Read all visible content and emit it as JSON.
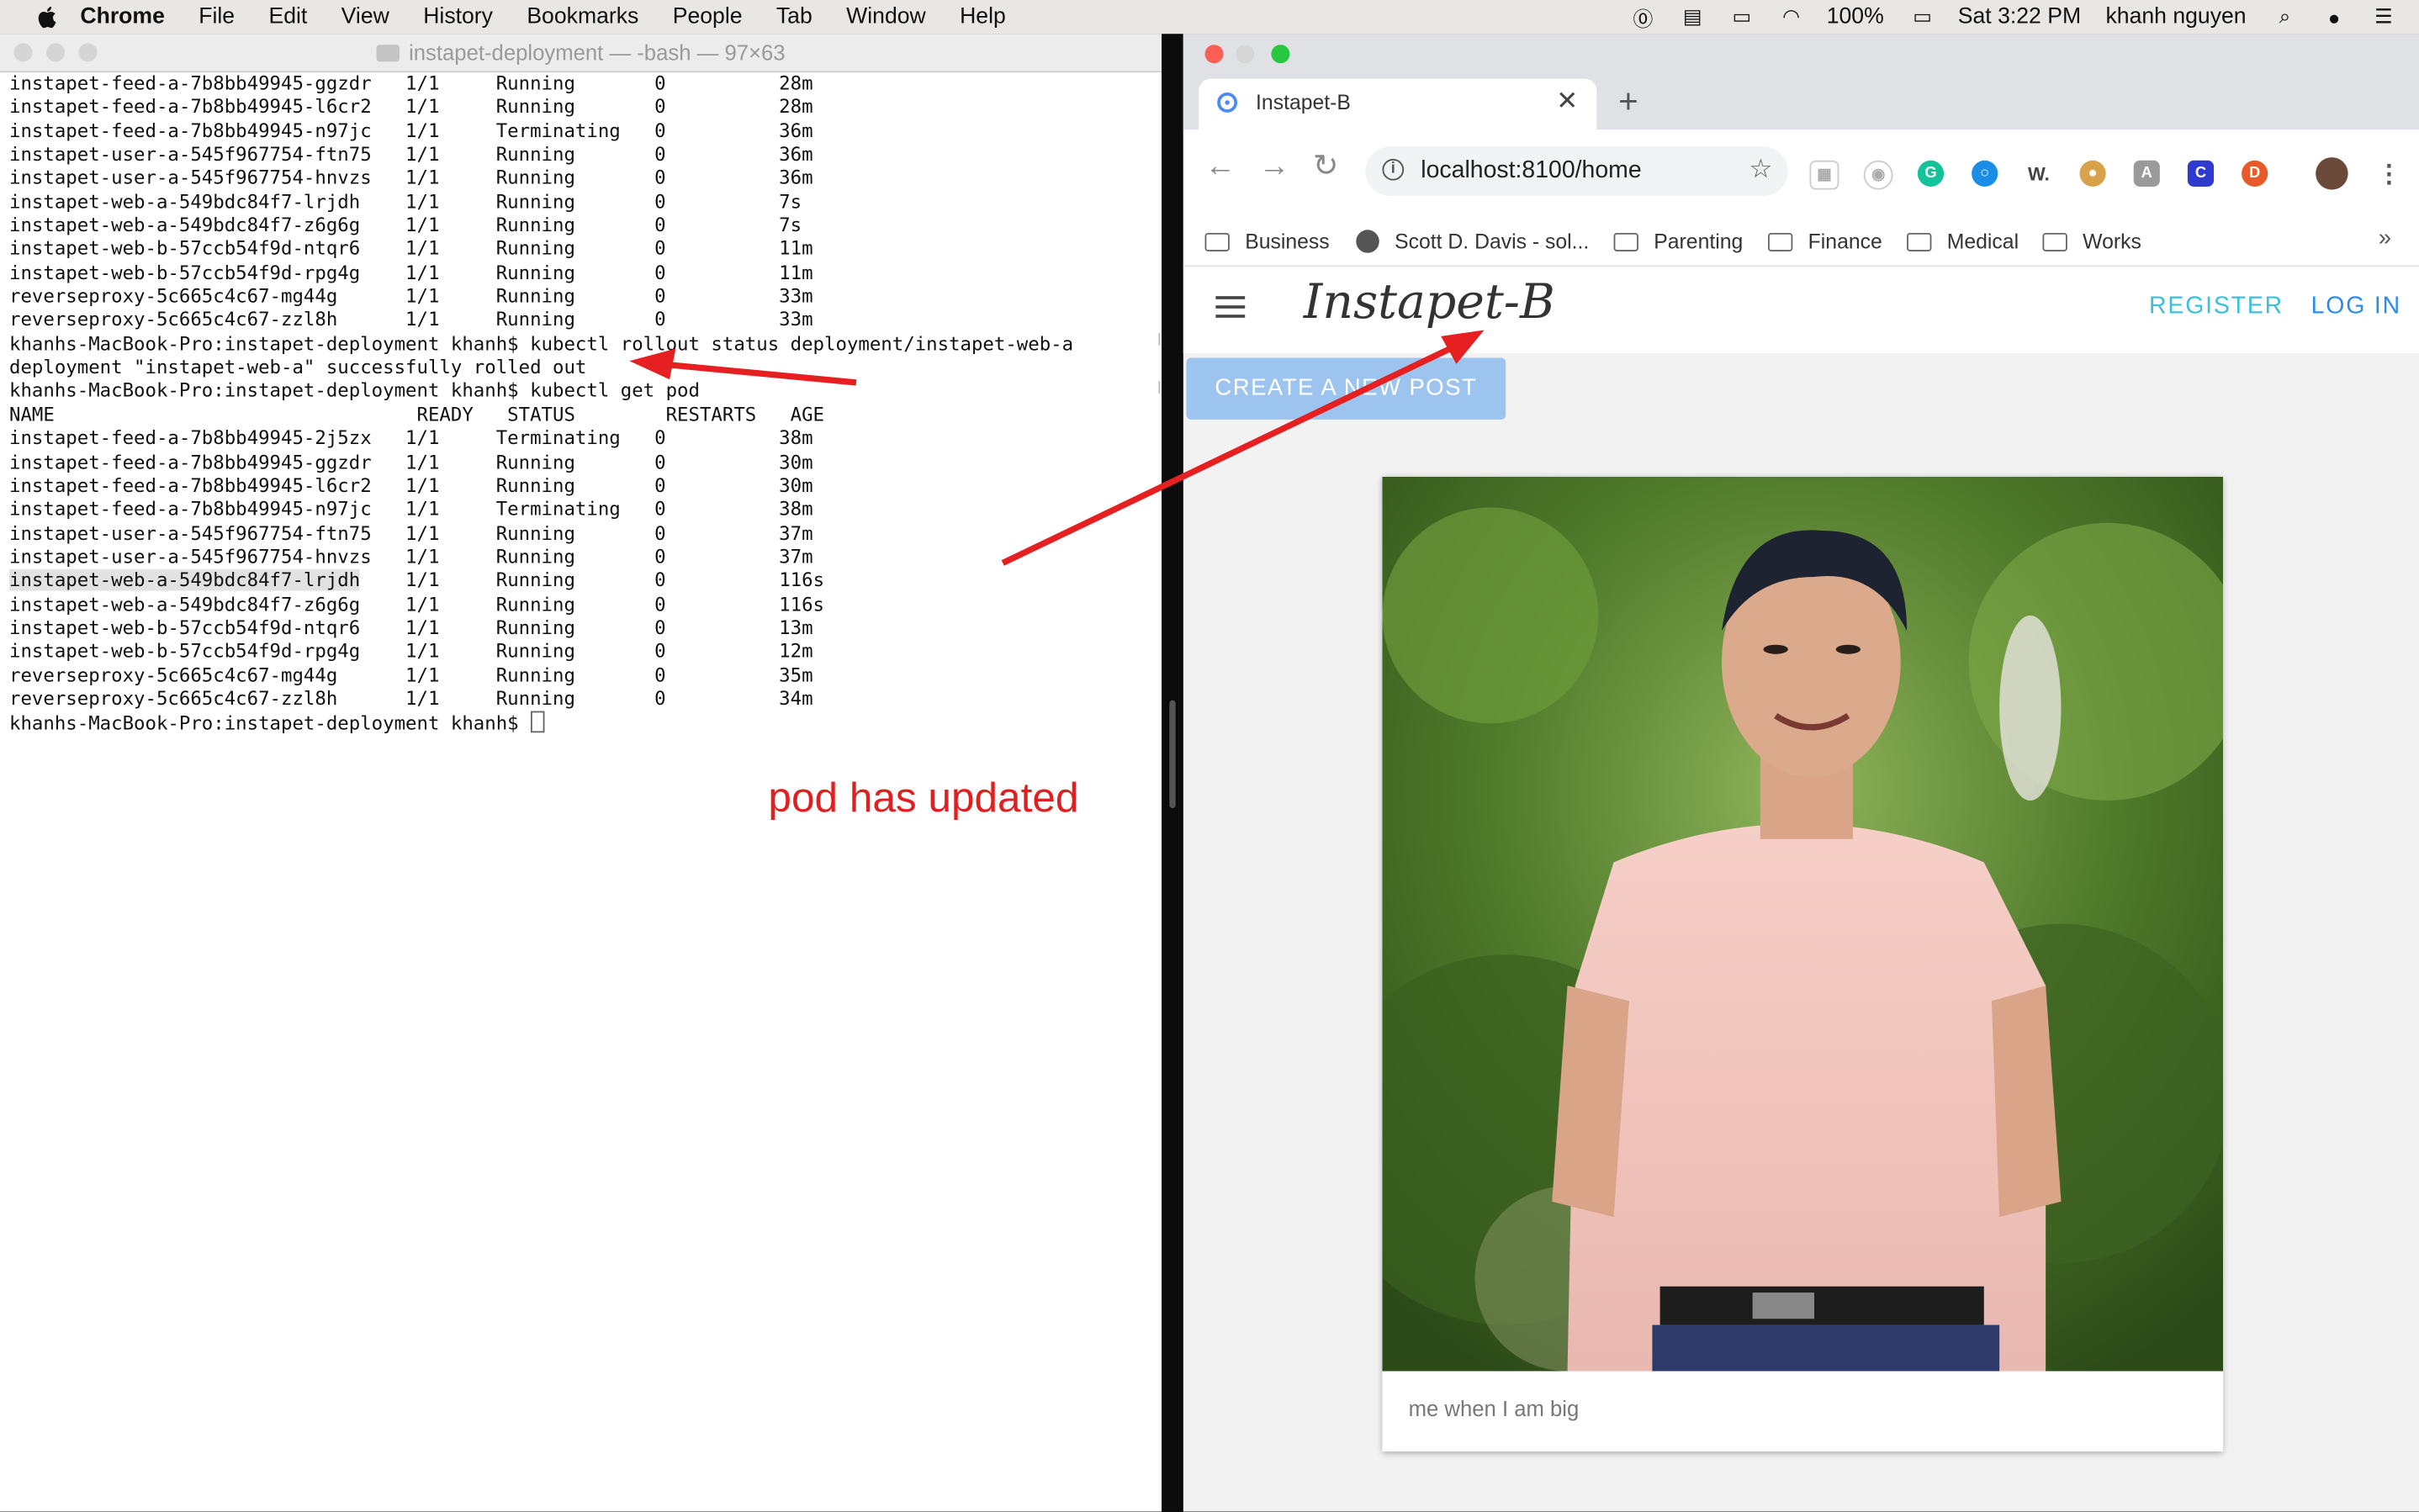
{
  "menubar": {
    "app_name": "Chrome",
    "items": [
      "File",
      "Edit",
      "View",
      "History",
      "Bookmarks",
      "People",
      "Tab",
      "Window",
      "Help"
    ],
    "battery": "100%",
    "clock": "Sat 3:22 PM",
    "user": "khanh nguyen"
  },
  "terminal": {
    "title": "instapet-deployment — -bash — 97×63",
    "lines": [
      "instapet-feed-a-7b8bb49945-ggzdr   1/1     Running       0          28m",
      "instapet-feed-a-7b8bb49945-l6cr2   1/1     Running       0          28m",
      "instapet-feed-a-7b8bb49945-n97jc   1/1     Terminating   0          36m",
      "instapet-user-a-545f967754-ftn75   1/1     Running       0          36m",
      "instapet-user-a-545f967754-hnvzs   1/1     Running       0          36m",
      "instapet-web-a-549bdc84f7-lrjdh    1/1     Running       0          7s",
      "instapet-web-a-549bdc84f7-z6g6g    1/1     Running       0          7s",
      "instapet-web-b-57ccb54f9d-ntqr6    1/1     Running       0          11m",
      "instapet-web-b-57ccb54f9d-rpg4g    1/1     Running       0          11m",
      "reverseproxy-5c665c4c67-mg44g      1/1     Running       0          33m",
      "reverseproxy-5c665c4c67-zzl8h      1/1     Running       0          33m",
      "khanhs-MacBook-Pro:instapet-deployment khanh$ kubectl rollout status deployment/instapet-web-a",
      "deployment \"instapet-web-a\" successfully rolled out",
      "khanhs-MacBook-Pro:instapet-deployment khanh$ kubectl get pod",
      "NAME                                READY   STATUS        RESTARTS   AGE",
      "instapet-feed-a-7b8bb49945-2j5zx   1/1     Terminating   0          38m",
      "instapet-feed-a-7b8bb49945-ggzdr   1/1     Running       0          30m",
      "instapet-feed-a-7b8bb49945-l6cr2   1/1     Running       0          30m",
      "instapet-feed-a-7b8bb49945-n97jc   1/1     Terminating   0          38m",
      "instapet-user-a-545f967754-ftn75   1/1     Running       0          37m",
      "instapet-user-a-545f967754-hnvzs   1/1     Running       0          37m",
      "instapet-web-a-549bdc84f7-lrjdh    1/1     Running       0          116s",
      "instapet-web-a-549bdc84f7-z6g6g    1/1     Running       0          116s",
      "instapet-web-b-57ccb54f9d-ntqr6    1/1     Running       0          13m",
      "instapet-web-b-57ccb54f9d-rpg4g    1/1     Running       0          12m",
      "reverseproxy-5c665c4c67-mg44g      1/1     Running       0          35m",
      "reverseproxy-5c665c4c67-zzl8h      1/1     Running       0          34m"
    ],
    "prompt": "khanhs-MacBook-Pro:instapet-deployment khanh$ ",
    "highlighted_pod": "instapet-web-a-549bdc84f7-lrjdh"
  },
  "annotation": {
    "text": "pod has updated",
    "color": "#e02020"
  },
  "browser": {
    "tab_title": "Instapet-B",
    "url": "localhost:8100/home",
    "bookmarks": [
      "Business",
      "Scott D. Davis - sol...",
      "Parenting",
      "Finance",
      "Medical",
      "Works"
    ]
  },
  "app": {
    "brand": "Instapet-B",
    "register_label": "REGISTER",
    "login_label": "LOG IN",
    "create_post_label": "CREATE A NEW POST",
    "post_caption": "me when I am big"
  }
}
